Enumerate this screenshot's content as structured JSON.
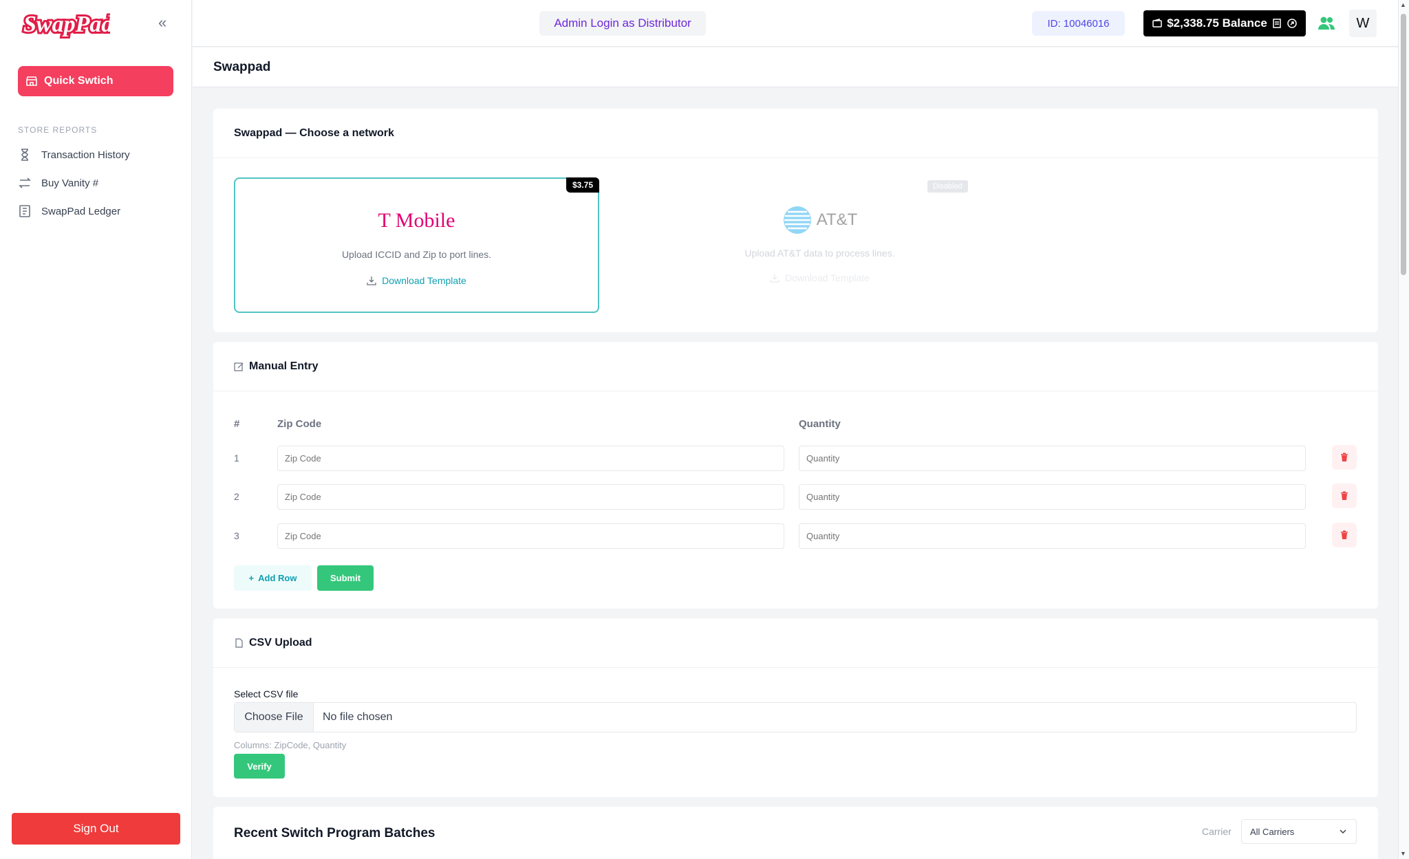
{
  "brand": {
    "logo_text": "SwapPad",
    "accent": "#f43f5e"
  },
  "sidebar": {
    "quick_switch_label": "Quick Swtich",
    "section_label": "STORE REPORTS",
    "items": [
      {
        "label": "Transaction History",
        "icon": "hourglass-icon"
      },
      {
        "label": "Buy Vanity #",
        "icon": "swap-arrows-icon"
      },
      {
        "label": "SwapPad Ledger",
        "icon": "ledger-icon"
      }
    ],
    "sign_out_label": "Sign Out"
  },
  "topbar": {
    "admin_label": "Admin Login as Distributor",
    "id_label": "ID: 10046016",
    "balance_label": "$2,338.75 Balance",
    "avatar_initial": "W"
  },
  "page": {
    "title": "Swappad"
  },
  "networks": {
    "heading": "Swappad — Choose a network",
    "tmobile": {
      "price": "$3.75",
      "logo_text": "T Mobile",
      "description": "Upload ICCID and Zip to port lines.",
      "download_label": "Download Template"
    },
    "att": {
      "badge": "Disabled",
      "logo_text": "AT&T",
      "description": "Upload AT&T data to process lines.",
      "download_label": "Download Template"
    }
  },
  "manual": {
    "heading": "Manual Entry",
    "col_num": "#",
    "col_zip": "Zip Code",
    "col_qty": "Quantity",
    "rows": [
      {
        "num": "1",
        "zip_placeholder": "Zip Code",
        "qty_placeholder": "Quantity"
      },
      {
        "num": "2",
        "zip_placeholder": "Zip Code",
        "qty_placeholder": "Quantity"
      },
      {
        "num": "3",
        "zip_placeholder": "Zip Code",
        "qty_placeholder": "Quantity"
      }
    ],
    "add_row_label": "Add Row",
    "submit_label": "Submit"
  },
  "csv": {
    "heading": "CSV Upload",
    "select_label": "Select CSV file",
    "choose_label": "Choose File",
    "file_name": "No file chosen",
    "hint": "Columns: ZipCode, Quantity",
    "verify_label": "Verify"
  },
  "batches": {
    "title": "Recent Switch Program Batches",
    "carrier_label": "Carrier",
    "carrier_value": "All Carriers"
  }
}
